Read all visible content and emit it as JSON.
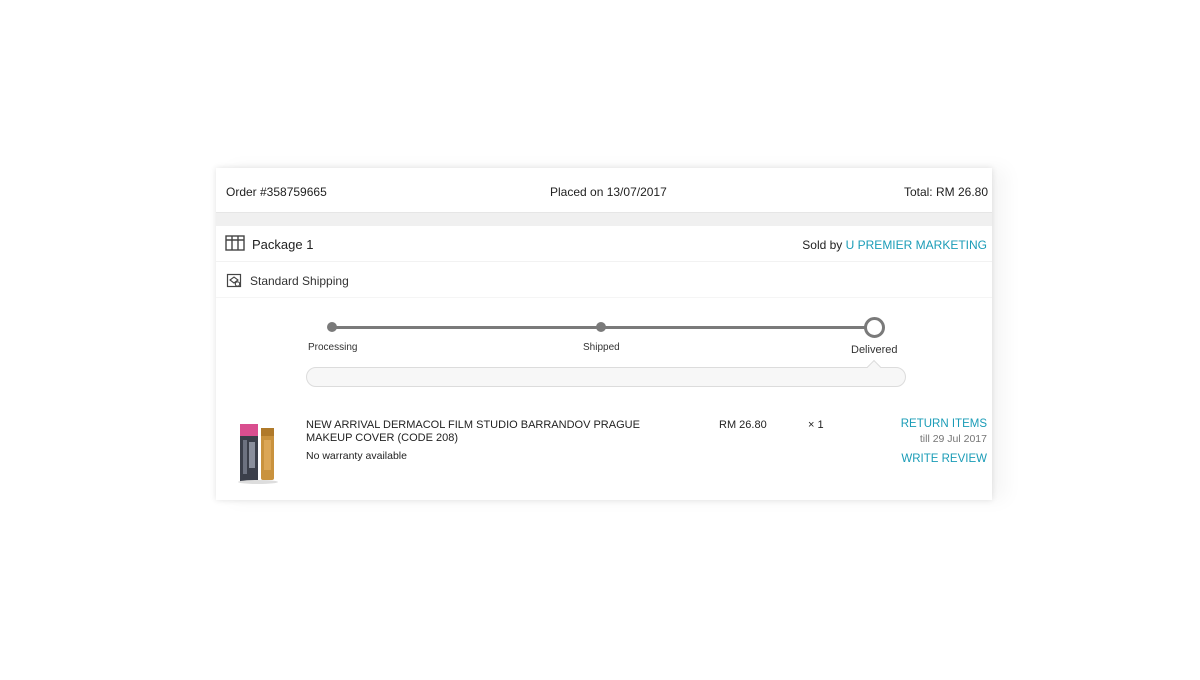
{
  "order": {
    "number": "Order #358759665",
    "placed": "Placed on 13/07/2017",
    "total": "Total: RM 26.80"
  },
  "package": {
    "title": "Package 1",
    "sold_by_prefix": "Sold by ",
    "seller": "U PREMIER MARKETING",
    "shipping_method": "Standard Shipping",
    "icons": [
      "package-icon",
      "shipping-icon"
    ]
  },
  "tracker": {
    "steps": [
      {
        "label": "Processing"
      },
      {
        "label": "Shipped"
      },
      {
        "label": "Delivered"
      }
    ],
    "current_step": "Delivered"
  },
  "item": {
    "name": "NEW ARRIVAL DERMACOL FILM STUDIO BARRANDOV PRAGUE MAKEUP COVER (CODE 208)",
    "warranty": "No warranty available",
    "price": "RM 26.80",
    "quantity": "× 1",
    "return_label": "RETURN ITEMS",
    "return_until": "till 29 Jul 2017",
    "review_label": "WRITE REVIEW"
  },
  "colors": {
    "link": "#1a9cb7",
    "tracker": "#7a7a7a"
  }
}
